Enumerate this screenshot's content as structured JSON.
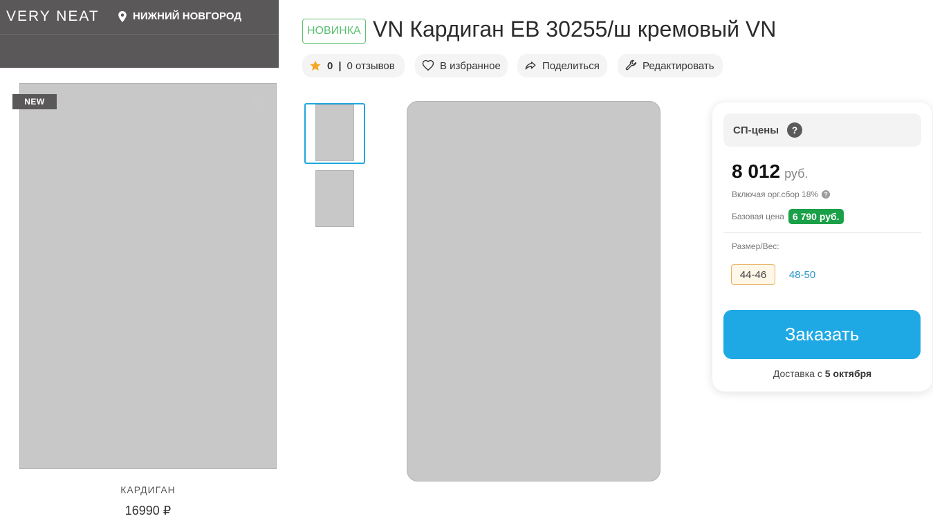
{
  "store": {
    "brand": "VERY  NEAT",
    "city": "НИЖНИЙ НОВГОРОД"
  },
  "card": {
    "new_tag": "NEW",
    "name": "КАРДИГАН",
    "price": "16990 ₽"
  },
  "product": {
    "badge": "НОВИНКА",
    "title": "VN Кардиган EB 30255/ш кремовый VN"
  },
  "actions": {
    "rating_value": "0",
    "rating_sep": "|",
    "reviews": "0 отзывов",
    "favorite": "В избранное",
    "share": "Поделиться",
    "edit": "Редактировать"
  },
  "panel": {
    "sp_label": "СП-цены",
    "help": "?",
    "price": "8 012",
    "currency": "руб.",
    "including": "Включая орг.сбор 18%",
    "base_label": "Базовая цена",
    "base_price": "6 790 руб.",
    "size_label": "Размер/Вес:",
    "sizes": [
      "44-46",
      "48-50"
    ],
    "order_button": "Заказать",
    "delivery_prefix": "Доставка с",
    "delivery_date": "5 октября"
  },
  "colors": {
    "accent": "#1ea9e4",
    "badge_green": "#5cc172",
    "base_price_green": "#1aa048",
    "brand_bar": "#5a5859",
    "star": "#f5a623"
  },
  "icons": [
    "location-pin-icon",
    "heart-icon",
    "star-icon",
    "share-icon",
    "wrench-icon",
    "help-icon"
  ]
}
